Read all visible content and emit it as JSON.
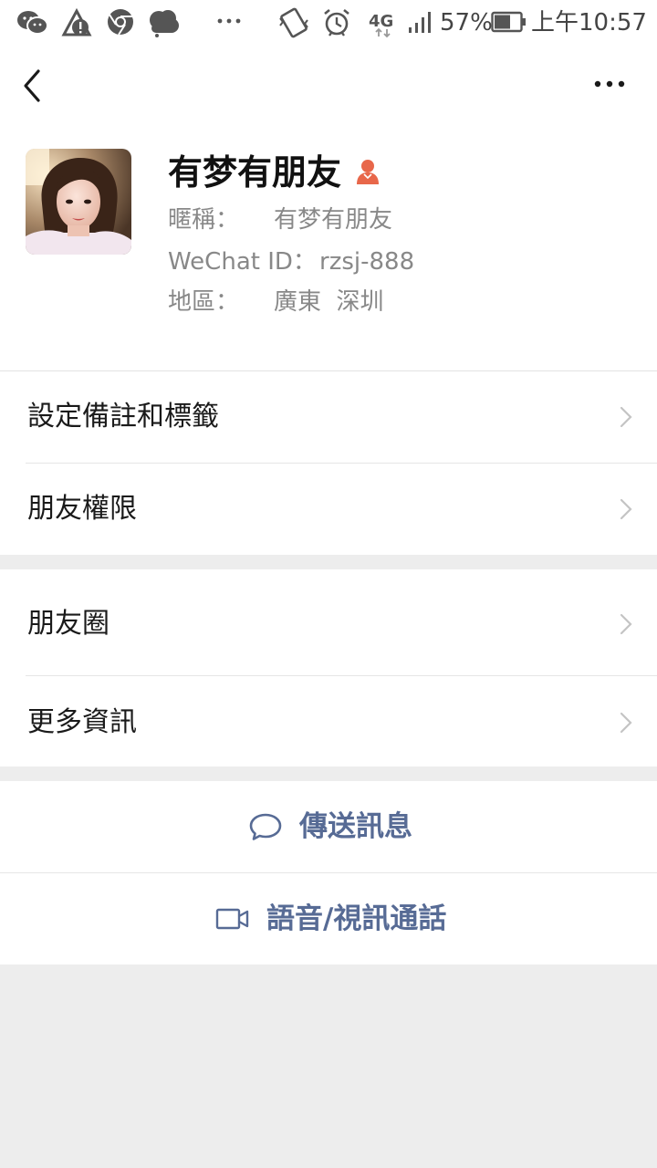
{
  "status_bar": {
    "network": "4G",
    "battery_percent": "57%",
    "time": "上午10:57",
    "icons": [
      "wechat-icon",
      "notification-icon",
      "chrome-icon",
      "cloud-icon",
      "overflow-dots-icon",
      "vibrate-icon",
      "alarm-icon",
      "signal-icon",
      "battery-icon"
    ]
  },
  "nav": {
    "back_icon": "chevron-left-icon",
    "more_icon": "more-dots-icon"
  },
  "profile": {
    "name": "有梦有朋友",
    "gender_icon": "female-user-icon",
    "nickname_label": "暱稱：",
    "nickname_value": "有梦有朋友",
    "wechat_id_label": "WeChat ID：",
    "wechat_id_value": "rzsj-888",
    "region_label": "地區：",
    "region_value": "廣東  深圳"
  },
  "menu_group_1": {
    "items": [
      {
        "label": "設定備註和標籤"
      },
      {
        "label": "朋友權限"
      }
    ]
  },
  "menu_group_2": {
    "items": [
      {
        "label": "朋友圈"
      },
      {
        "label": "更多資訊"
      }
    ]
  },
  "actions": {
    "send_message": {
      "label": "傳送訊息",
      "icon": "chat-bubble-icon"
    },
    "voice_video_call": {
      "label": "語音/視訊通話",
      "icon": "video-camera-icon"
    }
  },
  "colors": {
    "link_blue": "#576b95",
    "female_icon": "#e8674a",
    "page_background": "#ededed",
    "card_background": "#ffffff"
  }
}
